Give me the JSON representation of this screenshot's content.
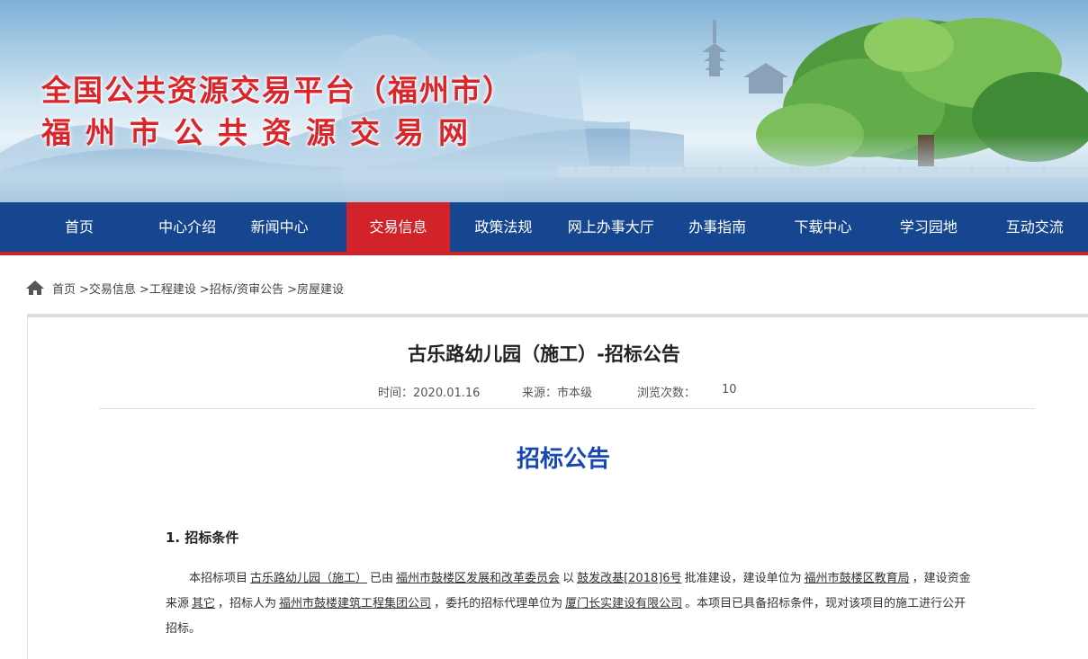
{
  "header": {
    "title_line1": "全国公共资源交易平台（福州市）",
    "title_line2": "福州市公共资源交易网"
  },
  "nav": {
    "items": [
      {
        "label": "首页",
        "active": false
      },
      {
        "label": "中心介绍",
        "active": false
      },
      {
        "label": "新闻中心",
        "active": false
      },
      {
        "label": "交易信息",
        "active": true
      },
      {
        "label": "政策法规",
        "active": false
      },
      {
        "label": "网上办事大厅",
        "active": false
      },
      {
        "label": "办事指南",
        "active": false
      },
      {
        "label": "下载中心",
        "active": false
      },
      {
        "label": "学习园地",
        "active": false
      },
      {
        "label": "互动交流",
        "active": false
      }
    ]
  },
  "breadcrumb": {
    "items": [
      "首页",
      ">交易信息",
      ">工程建设",
      ">招标/资审公告",
      ">房屋建设"
    ]
  },
  "article": {
    "title": "古乐路幼儿园（施工）-招标公告",
    "time_label": "时间：2020.01.16",
    "source_label": "来源：市本级",
    "views_label": "浏览次数：",
    "views_value": "10",
    "notice_heading": "招标公告",
    "section1_heading": "1. 招标条件",
    "para": {
      "t1": "本招标项目",
      "project": "古乐路幼儿园（施工）",
      "t2": "已由",
      "approver": "福州市鼓楼区发展和改革委员会",
      "t3": "以",
      "doc_no": "鼓发改基[2018]6号",
      "t4": "批准建设，建设单位为",
      "builder": "福州市鼓楼区教育局",
      "t5": "，建设资金来源",
      "fund": "其它",
      "t6": "，招标人为",
      "tenderer": "福州市鼓楼建筑工程集团公司",
      "t7": "，委托的招标代理单位为",
      "agent": "厦门长实建设有限公司",
      "t8": "。本项目已具备招标条件，现对该项目的施工进行公开招标。"
    }
  },
  "colors": {
    "nav_bg": "#15468f",
    "nav_active": "#d2232a",
    "title_red": "#d8262b",
    "notice_blue": "#1747b3"
  }
}
